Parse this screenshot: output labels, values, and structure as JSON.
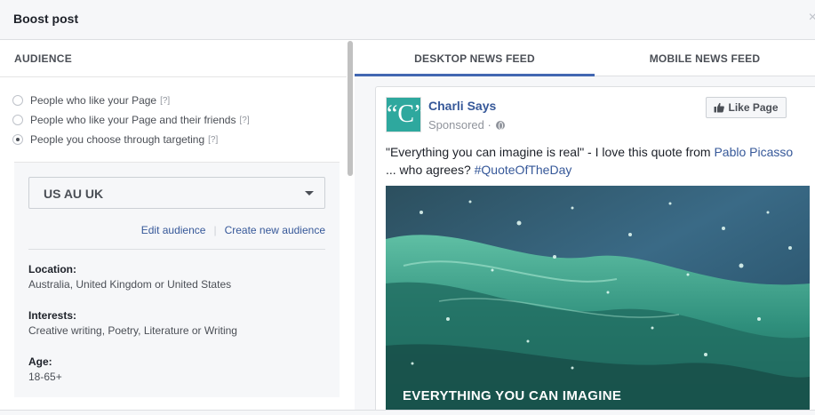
{
  "dialog": {
    "title": "Boost post",
    "close_icon": "×"
  },
  "audience": {
    "heading": "AUDIENCE",
    "options": [
      {
        "label": "People who like your Page",
        "help": "[?]",
        "selected": false
      },
      {
        "label": "People who like your Page and their friends",
        "help": "[?]",
        "selected": false
      },
      {
        "label": "People you choose through targeting",
        "help": "[?]",
        "selected": true
      }
    ],
    "selected_audience": "US AU UK",
    "edit_link": "Edit audience",
    "create_link": "Create new audience",
    "location_label": "Location:",
    "location_value": "Australia, United Kingdom or United States",
    "interests_label": "Interests:",
    "interests_value": "Creative writing, Poetry, Literature or Writing",
    "age_label": "Age:",
    "age_value": "18-65+"
  },
  "preview": {
    "tabs": [
      {
        "label": "DESKTOP NEWS FEED",
        "active": true
      },
      {
        "label": "MOBILE NEWS FEED",
        "active": false
      }
    ],
    "post": {
      "avatar_text": "“C”",
      "page_name": "Charli Says",
      "sponsored": "Sponsored ·",
      "like_button": "Like Page",
      "text_1": "\"Everything you can imagine is real\" - I love this quote from ",
      "text_link_1": "Pablo Picasso",
      "text_2": "... who agrees? ",
      "text_link_2": "#QuoteOfTheDay",
      "image_caption": "EVERYTHING YOU CAN IMAGINE"
    }
  },
  "colors": {
    "accent": "#4267b2",
    "link": "#365899",
    "avatar_bg": "#2ea89e"
  }
}
